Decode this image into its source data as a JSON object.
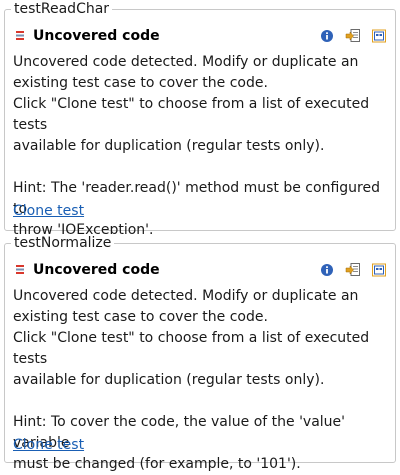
{
  "cards": [
    {
      "group_title": "testReadChar",
      "title": "Uncovered code",
      "line1": "Uncovered code detected. Modify or duplicate an",
      "line2": "existing test case to cover the code.",
      "line3": "Click \"Clone test\" to choose from a list of executed tests",
      "line4": "available for duplication (regular tests only).",
      "hint1": "Hint: The 'reader.read()' method must be configured to",
      "hint2": "throw 'IOException'.",
      "link": "Clone test",
      "icons": [
        "info-icon",
        "goto-source-icon",
        "clone-icon"
      ]
    },
    {
      "group_title": "testNormalize",
      "title": "Uncovered code",
      "line1": "Uncovered code detected. Modify or duplicate an",
      "line2": "existing test case to cover the code.",
      "line3": "Click \"Clone test\" to choose from a list of executed tests",
      "line4": "available for duplication (regular tests only).",
      "hint1": "Hint: To cover the code, the value of the 'value' variable",
      "hint2": "must be changed (for example, to '101').",
      "link": "Clone test",
      "icons": [
        "info-icon",
        "goto-source-icon",
        "clone-icon"
      ]
    }
  ],
  "colors": {
    "link": "#1a5fb4",
    "border": "#c8c8c8",
    "status_red": "#d9382d",
    "info_blue": "#2f62b8"
  }
}
